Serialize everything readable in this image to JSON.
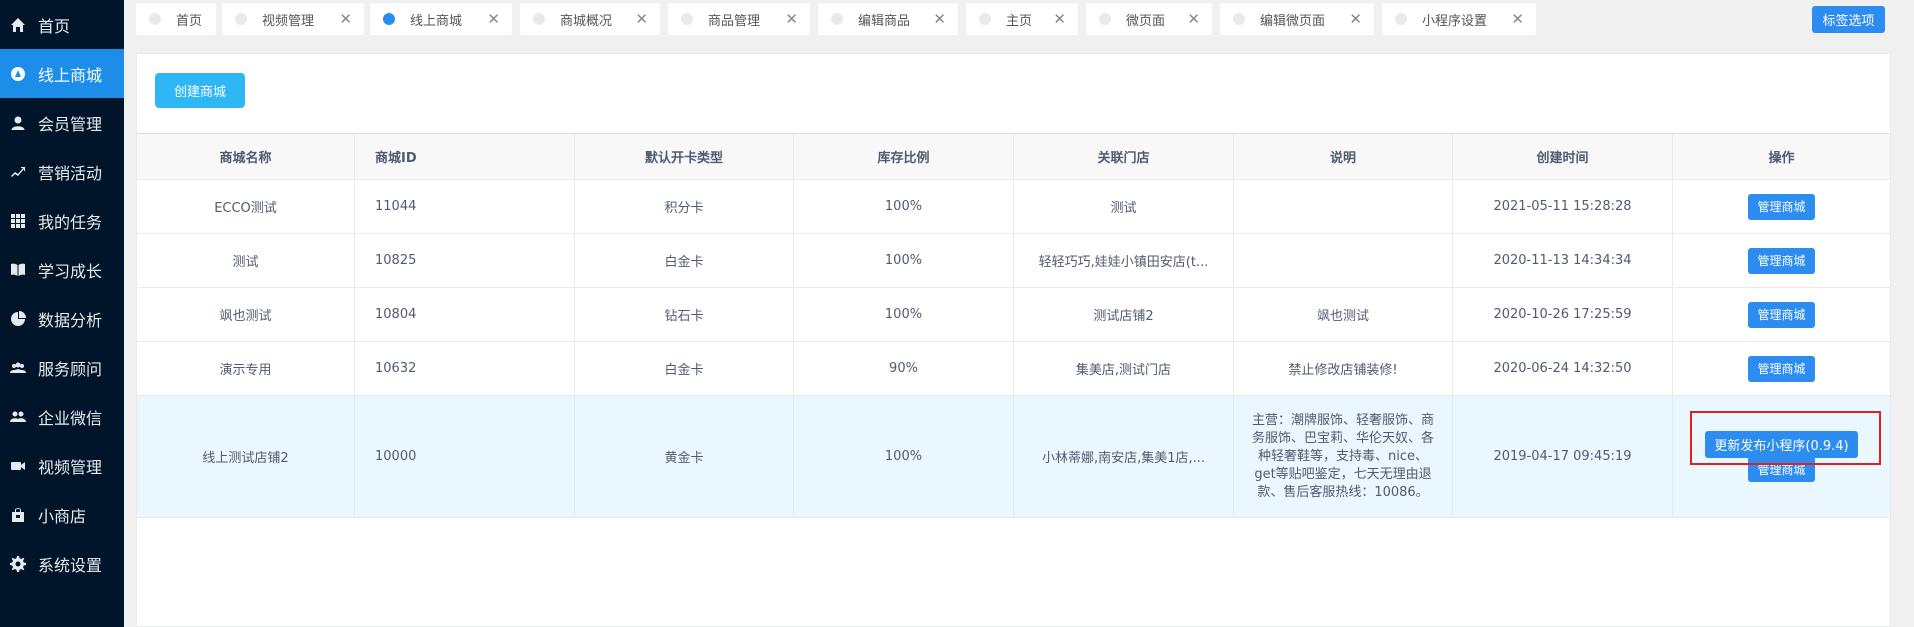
{
  "sidebar": {
    "items": [
      {
        "label": "首页",
        "icon": "home-icon",
        "active": false
      },
      {
        "label": "线上商城",
        "icon": "mall-icon",
        "active": true
      },
      {
        "label": "会员管理",
        "icon": "user-icon",
        "active": false
      },
      {
        "label": "营销活动",
        "icon": "trend-icon",
        "active": false
      },
      {
        "label": "我的任务",
        "icon": "grid-icon",
        "active": false
      },
      {
        "label": "学习成长",
        "icon": "book-icon",
        "active": false
      },
      {
        "label": "数据分析",
        "icon": "pie-icon",
        "active": false
      },
      {
        "label": "服务顾问",
        "icon": "group-icon",
        "active": false
      },
      {
        "label": "企业微信",
        "icon": "people-icon",
        "active": false
      },
      {
        "label": "视频管理",
        "icon": "video-icon",
        "active": false
      },
      {
        "label": "小商店",
        "icon": "shop-icon",
        "active": false
      },
      {
        "label": "系统设置",
        "icon": "gear-icon",
        "active": false
      }
    ]
  },
  "tabs": [
    {
      "label": "首页",
      "closable": false,
      "active": false
    },
    {
      "label": "视频管理",
      "closable": true,
      "active": false
    },
    {
      "label": "线上商城",
      "closable": true,
      "active": true
    },
    {
      "label": "商城概况",
      "closable": true,
      "active": false
    },
    {
      "label": "商品管理",
      "closable": true,
      "active": false
    },
    {
      "label": "编辑商品",
      "closable": true,
      "active": false
    },
    {
      "label": "主页",
      "closable": true,
      "active": false
    },
    {
      "label": "微页面",
      "closable": true,
      "active": false
    },
    {
      "label": "编辑微页面",
      "closable": true,
      "active": false
    },
    {
      "label": "小程序设置",
      "closable": true,
      "active": false
    }
  ],
  "tab_close_glyph": "✕",
  "tag_options_label": "标签选项",
  "create_button_label": "创建商城",
  "table": {
    "columns": [
      "商城名称",
      "商城ID",
      "默认开卡类型",
      "库存比例",
      "关联门店",
      "说明",
      "创建时间",
      "操作"
    ],
    "rows": [
      {
        "name": "ECCO测试",
        "id": "11044",
        "card": "积分卡",
        "ratio": "100%",
        "stores": "测试",
        "desc": "",
        "created": "2021-05-11 15:28:28"
      },
      {
        "name": "测试",
        "id": "10825",
        "card": "白金卡",
        "ratio": "100%",
        "stores": "轻轻巧巧,娃娃小镇田安店(t...",
        "desc": "",
        "created": "2020-11-13 14:34:34"
      },
      {
        "name": "飒也测试",
        "id": "10804",
        "card": "钻石卡",
        "ratio": "100%",
        "stores": "测试店铺2",
        "desc": "飒也测试",
        "created": "2020-10-26 17:25:59"
      },
      {
        "name": "演示专用",
        "id": "10632",
        "card": "白金卡",
        "ratio": "90%",
        "stores": "集美店,测试门店",
        "desc": "禁止修改店铺装修!",
        "created": "2020-06-24 14:32:50"
      },
      {
        "name": "线上测试店铺2",
        "id": "10000",
        "card": "黄金卡",
        "ratio": "100%",
        "stores": "小林蒂娜,南安店,集美1店,...",
        "desc": "主营：潮牌服饰、轻奢服饰、商务服饰、巴宝莉、华伦天奴、各种轻奢鞋等，支持毒、nice、get等贴吧鉴定，七天无理由退款、售后客服热线：10086。",
        "created": "2019-04-17 09:45:19"
      }
    ],
    "manage_label": "管理商城",
    "publish_label": "更新发布小程序(0.9.4)"
  },
  "colors": {
    "sidebar_bg": "#00152a",
    "primary": "#2d8cf0",
    "create_btn": "#2db7f5",
    "highlight": "#e02020"
  }
}
